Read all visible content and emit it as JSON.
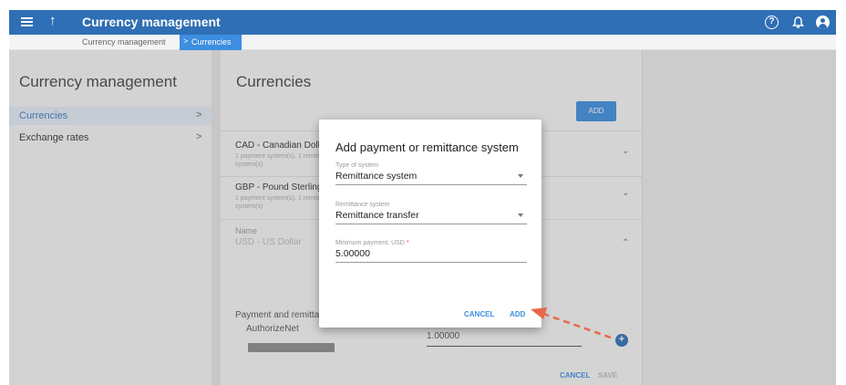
{
  "header": {
    "title": "Currency management",
    "up_symbol": "↑",
    "help_symbol": "?"
  },
  "breadcrumb": {
    "items": [
      "Currency management",
      "Currencies"
    ],
    "separator": ">"
  },
  "sidebar": {
    "title": "Currency management",
    "items": [
      {
        "label": "Currencies",
        "active": true
      },
      {
        "label": "Exchange rates",
        "active": false
      }
    ],
    "chevron": ">"
  },
  "main": {
    "title": "Currencies",
    "add_label": "ADD",
    "currencies": [
      {
        "name": "CAD - Canadian Doll",
        "sub": "1 payment system(s), 1 remittance system(s)"
      },
      {
        "name": "GBP - Pound Sterling",
        "sub": "1 payment system(s), 1 remittance system(s)"
      }
    ],
    "name_label": "Name",
    "name_value": "USD - US Dollar",
    "payment_label": "Payment and remitta",
    "payment_system": "AuthorizeNet",
    "payment_value": "1.00000",
    "cancel_label": "CANCEL",
    "save_label": "SAVE",
    "chevron_down": "⌄",
    "chevron_up": "⌃",
    "plus": "+"
  },
  "dialog": {
    "title": "Add payment or remittance system",
    "type_label": "Type of system",
    "type_value": "Remittance system",
    "remit_label": "Remittance system",
    "remit_value": "Remittance transfer",
    "min_label": "Minimum payment, USD",
    "min_required": "*",
    "min_value": "5.00000",
    "cancel_label": "CANCEL",
    "add_label": "ADD"
  },
  "colors": {
    "brand": "#2f6fb5",
    "accent": "#3d8ee0",
    "arrow": "#e8684a"
  }
}
